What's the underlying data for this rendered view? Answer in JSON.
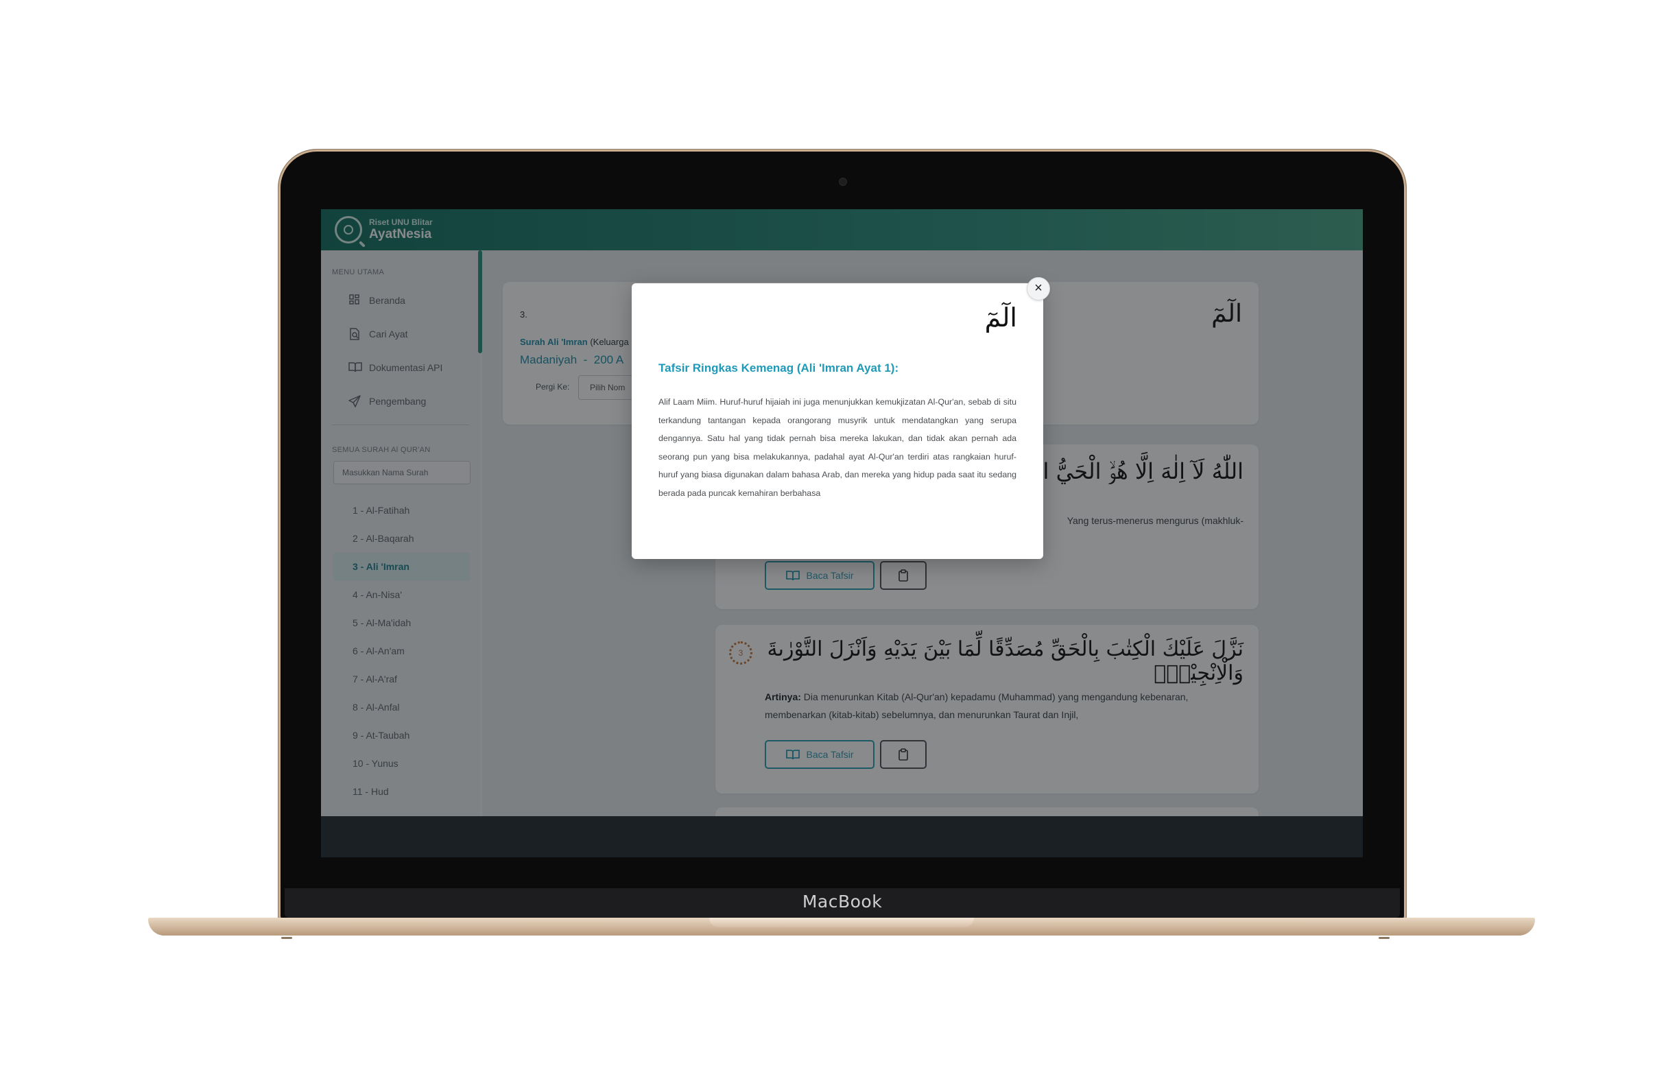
{
  "device": {
    "label": "MacBook"
  },
  "app": {
    "org": "Riset UNU Blitar",
    "name": "AyatNesia"
  },
  "sidebar": {
    "menu_heading": "MENU UTAMA",
    "menu": [
      {
        "label": "Beranda",
        "icon": "grid-icon"
      },
      {
        "label": "Cari Ayat",
        "icon": "search-document-icon"
      },
      {
        "label": "Dokumentasi API",
        "icon": "book-icon"
      },
      {
        "label": "Pengembang",
        "icon": "send-icon"
      }
    ],
    "surah_heading": "SEMUA SURAH Al QUR'AN",
    "search_placeholder": "Masukkan Nama Surah",
    "surahs": [
      "1 - Al-Fatihah",
      "2 - Al-Baqarah",
      "3 - Ali 'Imran",
      "4 - An-Nisa'",
      "5 - Al-Ma'idah",
      "6 - Al-An'am",
      "7 - Al-A'raf",
      "8 - Al-Anfal",
      "9 - At-Taubah",
      "10 - Yunus",
      "11 - Hud"
    ],
    "active_surah": "3 - Ali 'Imran"
  },
  "main": {
    "info": {
      "number": "3.",
      "surah_name": "Surah Ali 'Imran",
      "surah_meaning": "(Keluarga",
      "place": "Madaniyah",
      "separator": "-",
      "ayat_count": "200 A",
      "goto_label": "Pergi Ke:",
      "goto_select": "Pilih Nom"
    },
    "opening_arabic": "الٓمٓ",
    "ayah2": {
      "arabic": "اللّٰهُ لَآ اِلٰهَ اِلَّا هُوَۙ الْحَيُّ الْقَيُّوْمُ ۗ",
      "translation_tail": "Yang terus-menerus mengurus (makhluk-"
    },
    "ayah3": {
      "number": "3",
      "arabic": "نَزَّلَ عَلَيْكَ الْكِتٰبَ بِالْحَقِّ مُصَدِّقًا لِّمَا بَيْنَ يَدَيْهِ وَاَنْزَلَ التَّوْرٰىةَ وَالْاِنْجِيْلَۙ",
      "translation_label": "Artinya:",
      "translation_line1": "Dia menurunkan Kitab (Al-Qur'an) kepadamu (Muhammad) yang mengandung kebenaran,",
      "translation_line2": "membenarkan (kitab-kitab) sebelumnya, dan menurunkan Taurat dan Injil,"
    },
    "tafsir_button": "Baca Tafsir",
    "copy_icon": "clipboard-icon"
  },
  "modal": {
    "close_label": "×",
    "arabic": "الٓمٓ",
    "title": "Tafsir Ringkas Kemenag (Ali 'Imran Ayat 1):",
    "body": "Alif Laam Miim. Huruf-huruf hijaiah ini juga menunjukkan kemukjizatan Al-Qur'an, sebab di situ terkandung tantangan kepada orangorang musyrik untuk mendatangkan yang serupa dengannya. Satu hal yang tidak pernah bisa mereka lakukan, dan tidak akan pernah ada seorang pun yang bisa melakukannya, padahal ayat Al-Qur'an terdiri atas rangkaian huruf-huruf yang biasa digunakan dalam bahasa Arab, dan mereka yang hidup pada saat itu sedang berada pada puncak kemahiran berbahasa"
  },
  "colors": {
    "accent": "#1e9ab8",
    "header": "#2a8e7b",
    "overlay": "rgba(18,22,26,0.5)"
  }
}
